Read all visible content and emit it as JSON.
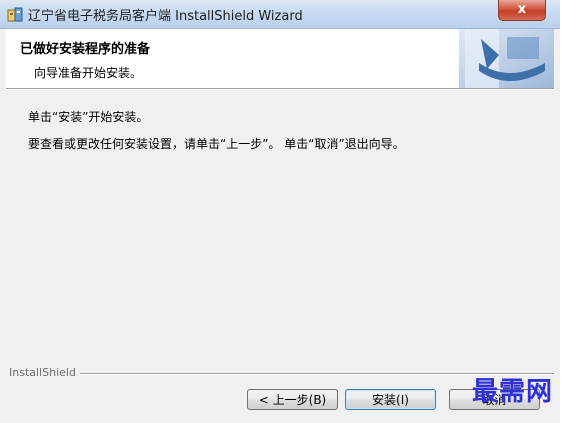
{
  "window": {
    "title": "辽宁省电子税务局客户端 InstallShield Wizard",
    "close_glyph": "x"
  },
  "header": {
    "title": "已做好安装程序的准备",
    "subtitle": "向导准备开始安装。"
  },
  "body": {
    "line1": "单击“安装”开始安装。",
    "line2": "要查看或更改任何安装设置，请单击“上一步”。 单击“取消”退出向导。"
  },
  "footer": {
    "brand": "InstallShield",
    "buttons": {
      "back": "< 上一步(B)",
      "install": "安装(I)",
      "cancel": "取消"
    }
  },
  "watermark": "最需网",
  "colors": {
    "titlebar": "#c7dbf1",
    "close": "#c73e25",
    "header_graphic": "#3f6fa8",
    "watermark": "#2f30d6"
  },
  "icons": [
    "installer-app-icon",
    "close-icon",
    "header-setup-graphic"
  ]
}
